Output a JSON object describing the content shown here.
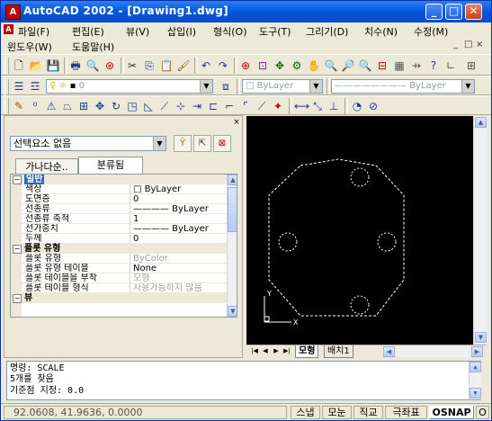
{
  "window": {
    "title": "AutoCAD 2002 - [Drawing1.dwg]",
    "app_icon_glyph": "A",
    "min_glyph": "_",
    "max_glyph": "□",
    "close_glyph": "✕"
  },
  "menu": {
    "row1": [
      "파일(F)",
      "편집(E)",
      "뷰(V)",
      "삽입(I)",
      "형식(O)",
      "도구(T)",
      "그리기(D)",
      "치수(N)",
      "수정(M)"
    ],
    "row2": [
      "윈도우(W)",
      "도움말(H)"
    ],
    "mdi_controls": [
      "_",
      "□",
      "×"
    ]
  },
  "toolbar_layers": {
    "layer_combo": "0",
    "color_combo": "ByLayer",
    "linetype_combo": "ByLayer"
  },
  "properties": {
    "close_glyph": "×",
    "selection": "선택요소 없음",
    "tabs": [
      "가나다순..",
      "분류됨"
    ],
    "active_tab": "분류됨",
    "categories": [
      {
        "name": "일반",
        "rows": [
          {
            "name": "색상",
            "value": "□ ByLayer",
            "dim": false
          },
          {
            "name": "도면층",
            "value": "0",
            "dim": false
          },
          {
            "name": "선종류",
            "value": "———— ByLayer",
            "dim": false
          },
          {
            "name": "선종류 축척",
            "value": "1",
            "dim": false
          },
          {
            "name": "선가중치",
            "value": "———— ByLayer",
            "dim": false
          },
          {
            "name": "두께",
            "value": "0",
            "dim": false
          }
        ]
      },
      {
        "name": "플롯 유형",
        "rows": [
          {
            "name": "플롯 유형",
            "value": "ByColor",
            "dim": true
          },
          {
            "name": "플롯 유형 테이블",
            "value": "None",
            "dim": false
          },
          {
            "name": "플롯 테이블을 부착",
            "value": "모형",
            "dim": true
          },
          {
            "name": "플롯 테이블 형식",
            "value": "사용가능하지 않음",
            "dim": true
          }
        ]
      },
      {
        "name": "뷰",
        "rows": []
      }
    ]
  },
  "layout_tabs": [
    "모형",
    "배치1"
  ],
  "command_lines": [
    "명령: SCALE",
    "5개를 찾음",
    "기준점 지정: 0.0"
  ],
  "status": {
    "coords": "92.0608, 41.9636, 0.0000",
    "buttons": [
      "스냅",
      "모눈",
      "직교",
      "극좌표",
      "OSNAP",
      "O"
    ]
  }
}
